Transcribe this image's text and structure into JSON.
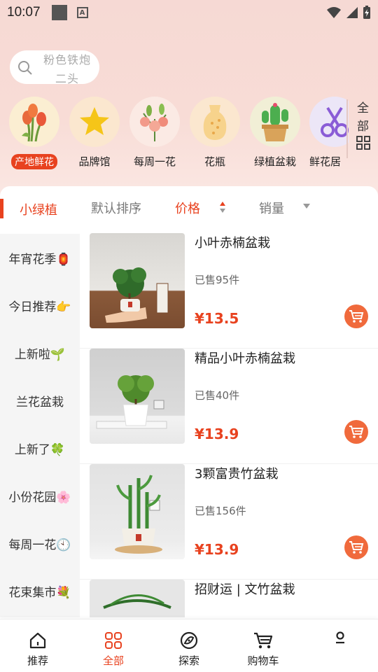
{
  "status_bar": {
    "time": "10:07"
  },
  "search": {
    "placeholder_line1": "粉色铁炮",
    "placeholder_line2": "二头"
  },
  "categories": [
    {
      "label": "产地鲜花",
      "icon": "tulip-icon",
      "active": true
    },
    {
      "label": "品牌馆",
      "icon": "star-icon"
    },
    {
      "label": "每周一花",
      "icon": "bouquet-icon"
    },
    {
      "label": "花瓶",
      "icon": "vase-icon"
    },
    {
      "label": "绿植盆栽",
      "icon": "cactus-icon"
    },
    {
      "label": "鲜花居",
      "icon": "scissors-icon"
    }
  ],
  "all_button": {
    "line1": "全",
    "line2": "部"
  },
  "sort_bar": {
    "category": "小绿植",
    "default_sort": "默认排序",
    "price": "价格",
    "sales": "销量"
  },
  "sidebar": {
    "items": [
      {
        "label": "年宵花季🏮"
      },
      {
        "label": "今日推荐👉"
      },
      {
        "label": "上新啦🌱"
      },
      {
        "label": "兰花盆栽"
      },
      {
        "label": "上新了🍀"
      },
      {
        "label": "小份花园🌸"
      },
      {
        "label": "每周一花🕙"
      },
      {
        "label": "花束集市💐"
      }
    ]
  },
  "products": [
    {
      "name": "小叶赤楠盆栽",
      "sold": "已售95件",
      "price": "¥13.5"
    },
    {
      "name": "精品小叶赤楠盆栽",
      "sold": "已售40件",
      "price": "¥13.9"
    },
    {
      "name": "3颗富贵竹盆栽",
      "sold": "已售156件",
      "price": "¥13.9"
    },
    {
      "name": "招财运 | 文竹盆栽",
      "sold": "",
      "price": ""
    }
  ],
  "bottom_nav": {
    "items": [
      {
        "label": "推荐",
        "icon": "home-icon"
      },
      {
        "label": "全部",
        "icon": "grid-icon",
        "active": true
      },
      {
        "label": "探索",
        "icon": "explore-icon"
      },
      {
        "label": "购物车",
        "icon": "cart-icon"
      },
      {
        "label": "",
        "icon": "profile-icon"
      }
    ]
  },
  "colors": {
    "accent": "#e8421f",
    "cart_button": "#f06a3c",
    "sidebar_bg": "#f5f5f5"
  }
}
